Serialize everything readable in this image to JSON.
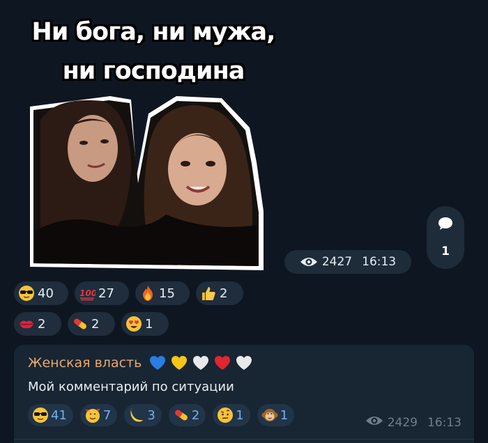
{
  "sticker": {
    "title_line1": "Ни бога, ни мужа,",
    "title_line2": "ни господина"
  },
  "post_meta": {
    "views": "2427",
    "time": "16:13",
    "icon": "eye-icon"
  },
  "comments_button": {
    "count": "1",
    "icon": "comment-bubble-icon"
  },
  "post_reactions": [
    {
      "emoji": "sunglasses-face-icon",
      "count": "40"
    },
    {
      "emoji": "hundred-points-icon",
      "count": "27"
    },
    {
      "emoji": "fire-icon",
      "count": "15"
    },
    {
      "emoji": "thumbs-up-icon",
      "count": "2"
    },
    {
      "emoji": "kiss-lips-icon",
      "count": "2"
    },
    {
      "emoji": "pill-icon",
      "count": "2"
    },
    {
      "emoji": "heart-eyes-face-icon",
      "count": "1"
    }
  ],
  "comment": {
    "author": "Женская власть",
    "author_hearts": [
      "blue-heart",
      "yellow-heart",
      "white-heart",
      "red-heart",
      "white-heart"
    ],
    "text": "Мой комментарий по ситуации",
    "reactions": [
      {
        "emoji": "sunglasses-face-icon",
        "count": "41"
      },
      {
        "emoji": "smiling-face-with-hearts-icon",
        "count": "7"
      },
      {
        "emoji": "banana-icon",
        "count": "3"
      },
      {
        "emoji": "pill-icon",
        "count": "2"
      },
      {
        "emoji": "raised-eyebrow-face-icon",
        "count": "1"
      },
      {
        "emoji": "monkey-face-icon",
        "count": "1"
      }
    ],
    "views": "2429",
    "time": "16:13"
  },
  "colors": {
    "background": "#0e1621",
    "pill": "#1e2c3a",
    "author": "#e8a870",
    "reaction_count_accent": "#6fb2ee"
  }
}
